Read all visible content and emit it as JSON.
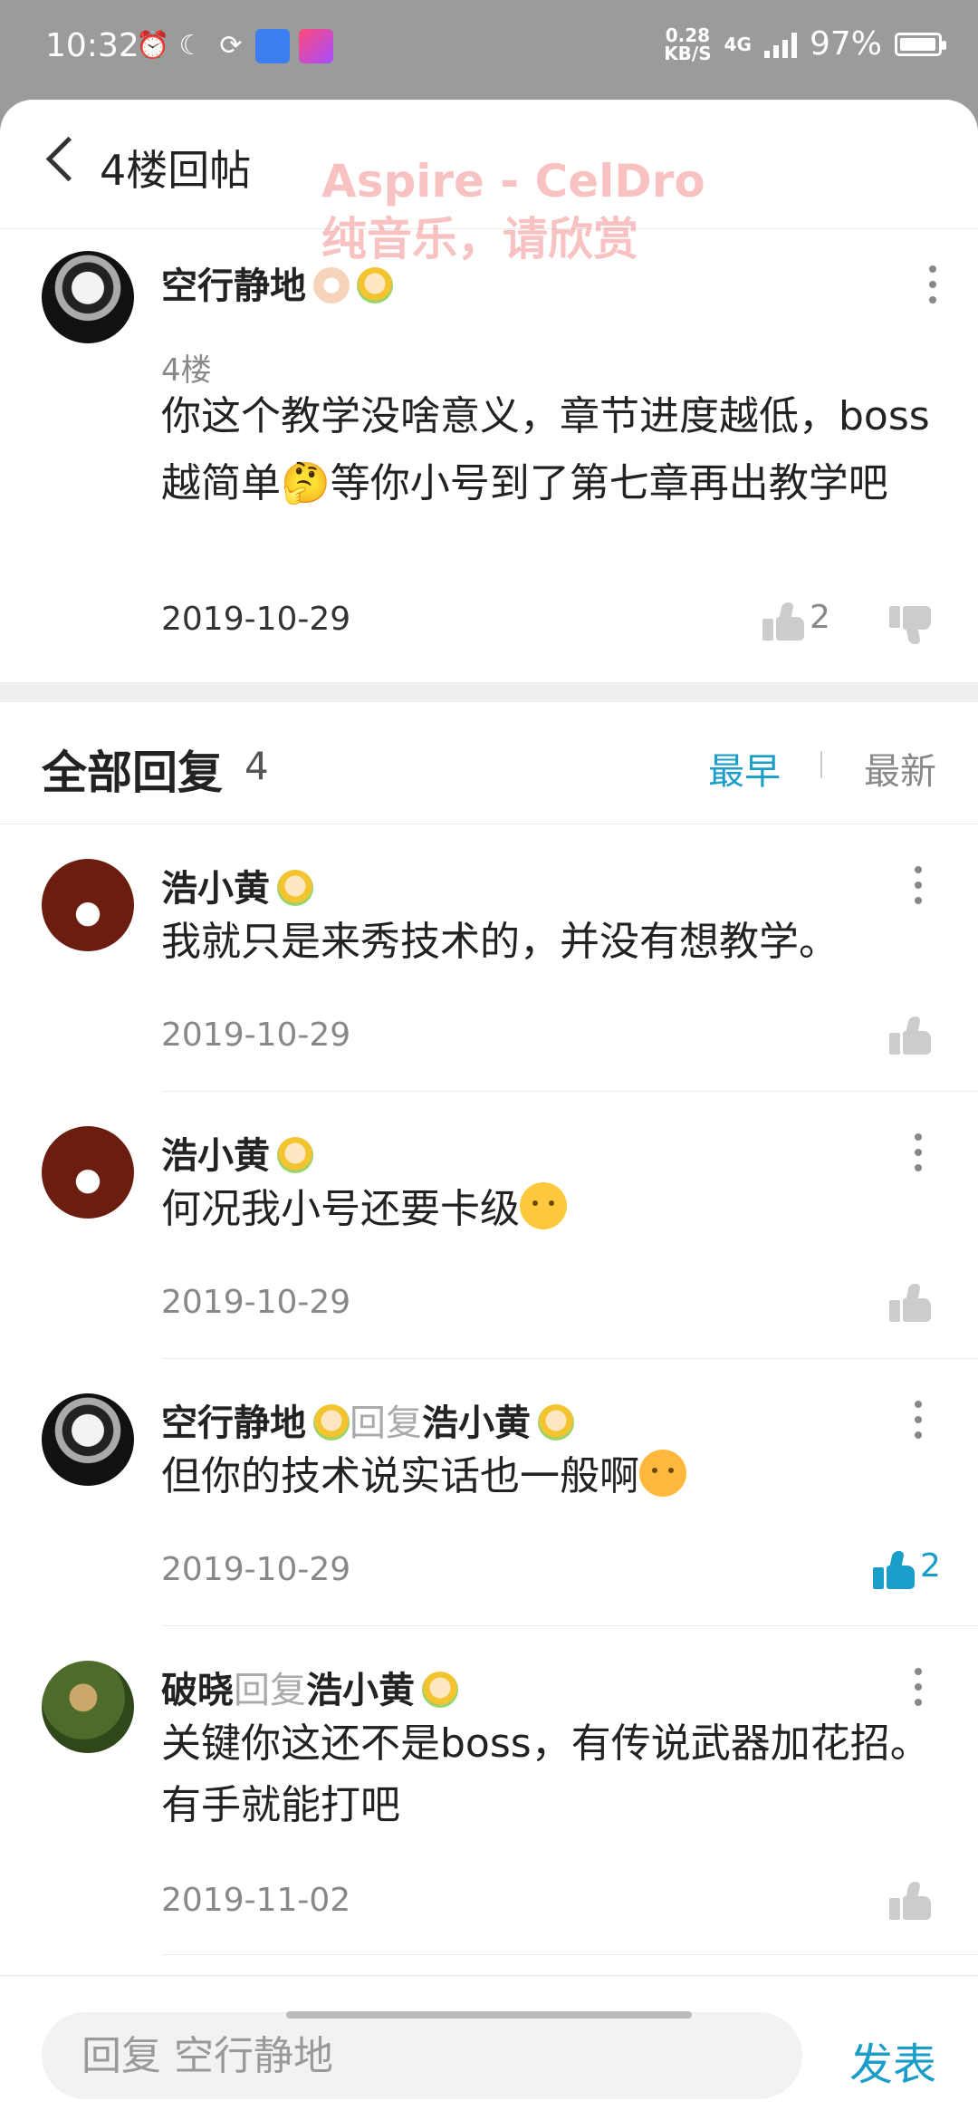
{
  "status_bar": {
    "time": "10:32",
    "speed_value": "0.28",
    "speed_unit": "KB/S",
    "network": "4G",
    "battery": "97%",
    "battery_level": 0.97
  },
  "header": {
    "title": "4楼回帖",
    "watermark_line1": "Aspire - CelDro",
    "watermark_line2": "纯音乐，请欣赏"
  },
  "post": {
    "username": "空行静地",
    "floor": "4楼",
    "body": "你这个教学没啥意义，章节进度越低，boss越简单🤔等你小号到了第七章再出教学吧",
    "date": "2019-10-29",
    "like_count": "2"
  },
  "replies_section": {
    "title": "全部回复",
    "count": "4",
    "sort_earliest": "最早",
    "sort_latest": "最新"
  },
  "replies": [
    {
      "username": "浩小黄",
      "reply_word": "",
      "target": "",
      "body": "我就只是来秀技术的，并没有想教学。",
      "date": "2019-10-29",
      "like_count": ""
    },
    {
      "username": "浩小黄",
      "reply_word": "",
      "target": "",
      "body": "何况我小号还要卡级",
      "date": "2019-10-29",
      "like_count": ""
    },
    {
      "username": "空行静地",
      "reply_word": "回复",
      "target": "浩小黄",
      "body": "但你的技术说实话也一般啊",
      "date": "2019-10-29",
      "like_count": "2"
    },
    {
      "username": "破晓",
      "reply_word": "回复",
      "target": "浩小黄",
      "body": "关键你这还不是boss，有传说武器加花招。有手就能打吧",
      "date": "2019-11-02",
      "like_count": ""
    }
  ],
  "composer": {
    "placeholder": "回复 空行静地",
    "submit_label": "发表"
  },
  "colors": {
    "accent": "#1a9ec9",
    "watermark": "#f07878"
  }
}
